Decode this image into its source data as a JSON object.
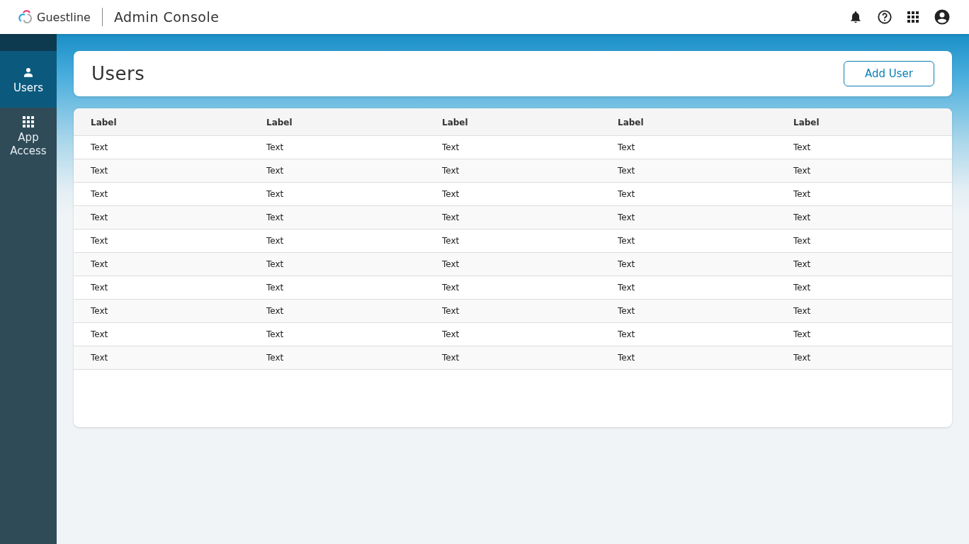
{
  "header": {
    "brand": "Guestline",
    "app_title": "Admin Console"
  },
  "sidebar": {
    "items": [
      {
        "label": "Users",
        "kind": "person",
        "selected": true
      },
      {
        "label": "App Access",
        "kind": "grid",
        "selected": false
      }
    ]
  },
  "page": {
    "title": "Users",
    "action": "Add User"
  },
  "table": {
    "columns": [
      "Label",
      "Label",
      "Label",
      "Label",
      "Label"
    ],
    "rows": [
      [
        "Text",
        "Text",
        "Text",
        "Text",
        "Text"
      ],
      [
        "Text",
        "Text",
        "Text",
        "Text",
        "Text"
      ],
      [
        "Text",
        "Text",
        "Text",
        "Text",
        "Text"
      ],
      [
        "Text",
        "Text",
        "Text",
        "Text",
        "Text"
      ],
      [
        "Text",
        "Text",
        "Text",
        "Text",
        "Text"
      ],
      [
        "Text",
        "Text",
        "Text",
        "Text",
        "Text"
      ],
      [
        "Text",
        "Text",
        "Text",
        "Text",
        "Text"
      ],
      [
        "Text",
        "Text",
        "Text",
        "Text",
        "Text"
      ],
      [
        "Text",
        "Text",
        "Text",
        "Text",
        "Text"
      ],
      [
        "Text",
        "Text",
        "Text",
        "Text",
        "Text"
      ]
    ]
  }
}
